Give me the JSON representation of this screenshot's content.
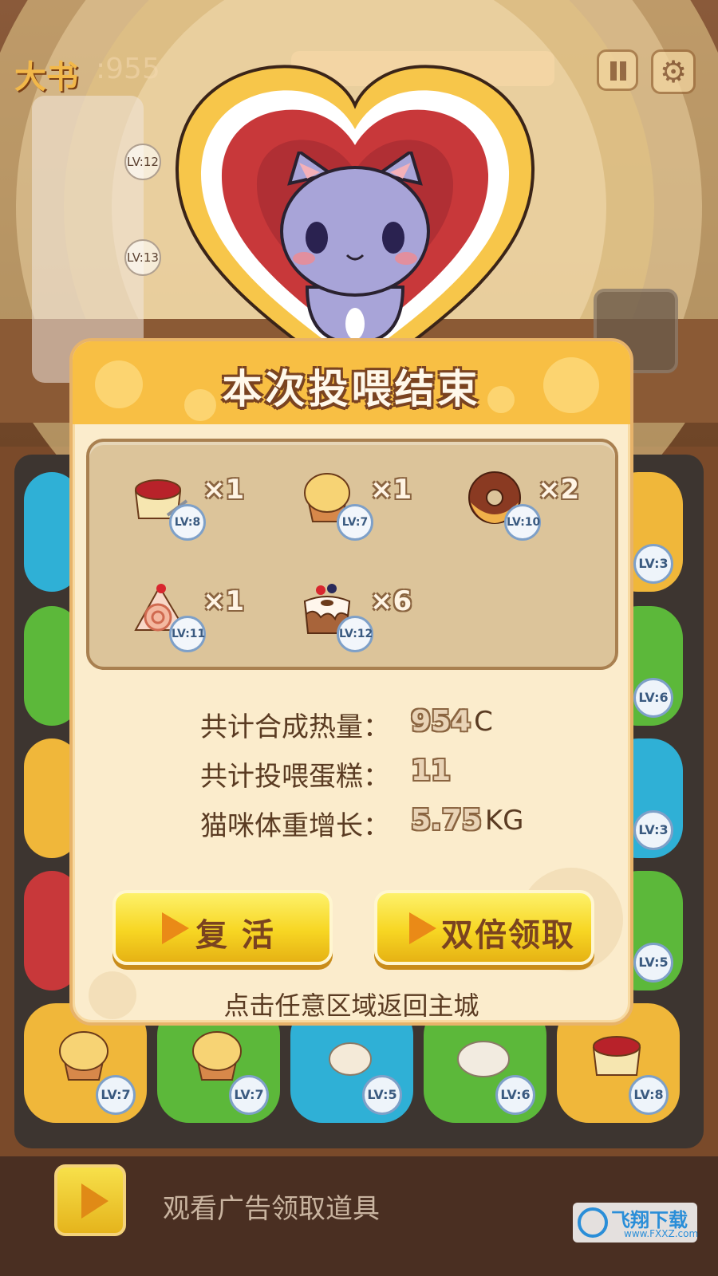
{
  "hud": {
    "score_label": "大书",
    "score_value": ":955"
  },
  "side_stack": [
    {
      "level": "LV:12"
    },
    {
      "level": "LV:13"
    }
  ],
  "board": {
    "tiles": [
      {
        "color": "#f0b73a",
        "level": "LV:7"
      },
      {
        "color": "#5cb83a",
        "level": "LV:7"
      },
      {
        "color": "#2fb0d6",
        "level": "LV:5"
      },
      {
        "color": "#5cb83a",
        "level": "LV:6"
      },
      {
        "color": "#f0b73a",
        "level": "LV:8"
      }
    ],
    "edge_badges": [
      "LV:3",
      "LV:6",
      "LV:3",
      "LV:5"
    ]
  },
  "dialog": {
    "title": "本次投喂结束",
    "rewards": [
      {
        "icon": "pudding-icon",
        "level": "LV:8",
        "qty": "×1"
      },
      {
        "icon": "muffin-icon",
        "level": "LV:7",
        "qty": "×1"
      },
      {
        "icon": "donut-icon",
        "level": "LV:10",
        "qty": "×2"
      },
      {
        "icon": "swiss-roll-icon",
        "level": "LV:11",
        "qty": "×1"
      },
      {
        "icon": "bundt-cake-icon",
        "level": "LV:12",
        "qty": "×6"
      }
    ],
    "stats": [
      {
        "label": "共计合成热量：",
        "value": "954",
        "unit": "C"
      },
      {
        "label": "共计投喂蛋糕：",
        "value": "11",
        "unit": ""
      },
      {
        "label": "猫咪体重增长：",
        "value": "5.75",
        "unit": "KG"
      }
    ],
    "revive_label": "复 活",
    "double_label": "双倍领取",
    "hint": "点击任意区域返回主城"
  },
  "footer": {
    "ad_text": "观看广告领取道具"
  },
  "watermark": {
    "main": "飞翔下载",
    "sub": "www.FXXZ.com"
  },
  "colors": {
    "dialog_header": "#f8bf44",
    "button_yellow": "#f7d623",
    "heart_red": "#c8383a"
  }
}
